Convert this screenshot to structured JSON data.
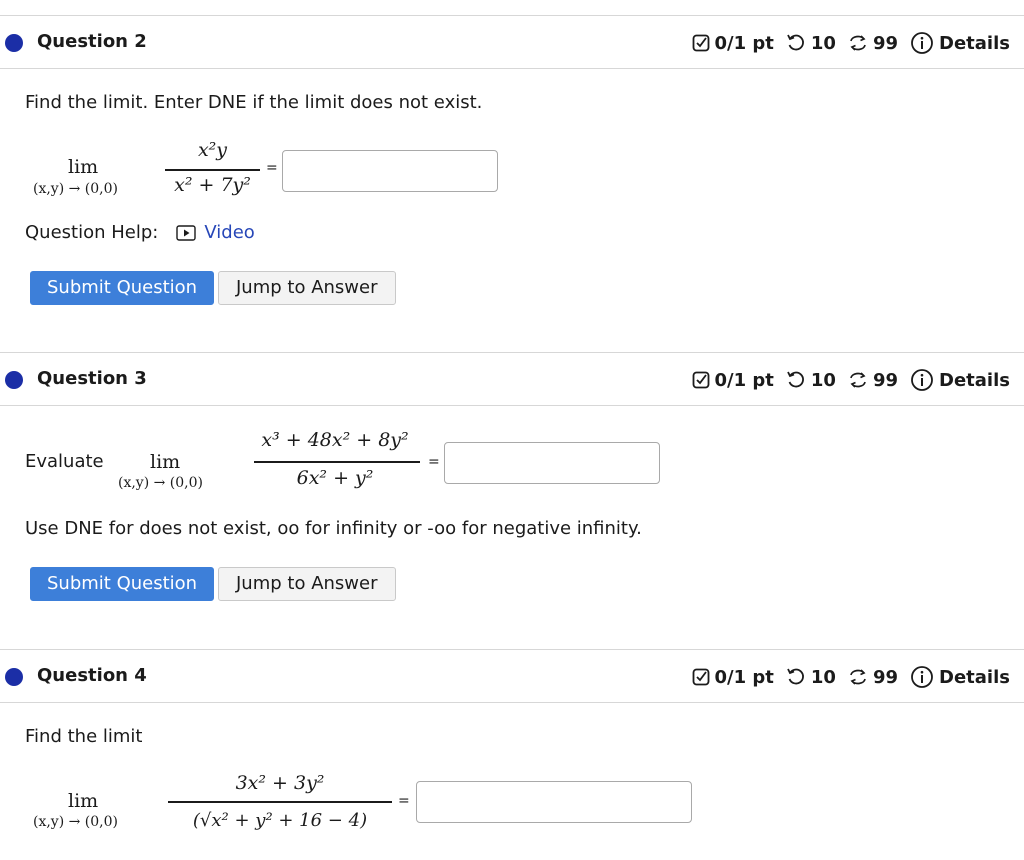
{
  "meta_icons": {
    "score": "checkbox-score-icon",
    "retry": "retry-icon",
    "attempts": "attempts-cycle-icon",
    "details": "info-circle-icon"
  },
  "colors": {
    "dot": "#1b2ea6",
    "submit": "#3d7fd9",
    "link": "#2747b8"
  },
  "q2": {
    "title": "Question 2",
    "score": "0/1 pt",
    "retries": "10",
    "attempts": "99",
    "details": "Details",
    "prompt": "Find the limit. Enter DNE if the limit does not exist.",
    "lim": "lim",
    "lim_sub": "(x,y) → (0,0)",
    "numerator": "x²y",
    "denominator": "x² + 7y²",
    "equals": "=",
    "answer": "",
    "help_label": "Question Help:",
    "help_link": "Video",
    "submit": "Submit Question",
    "jump": "Jump to Answer"
  },
  "q3": {
    "title": "Question 3",
    "score": "0/1 pt",
    "retries": "10",
    "attempts": "99",
    "details": "Details",
    "lead": "Evaluate",
    "lim": "lim",
    "lim_sub": "(x,y) → (0,0)",
    "numerator": "x³ + 48x² + 8y²",
    "denominator": "6x² + y²",
    "equals": "=",
    "answer": "",
    "note": "Use DNE for does not exist, oo for infinity or -oo for negative infinity.",
    "submit": "Submit Question",
    "jump": "Jump to Answer"
  },
  "q4": {
    "title": "Question 4",
    "score": "0/1 pt",
    "retries": "10",
    "attempts": "99",
    "details": "Details",
    "prompt": "Find the limit",
    "lim": "lim",
    "lim_sub": "(x,y) → (0,0)",
    "numerator": "3x² + 3y²",
    "denominator": "(√x² + y² + 16 − 4)",
    "equals": "=",
    "answer": ""
  }
}
